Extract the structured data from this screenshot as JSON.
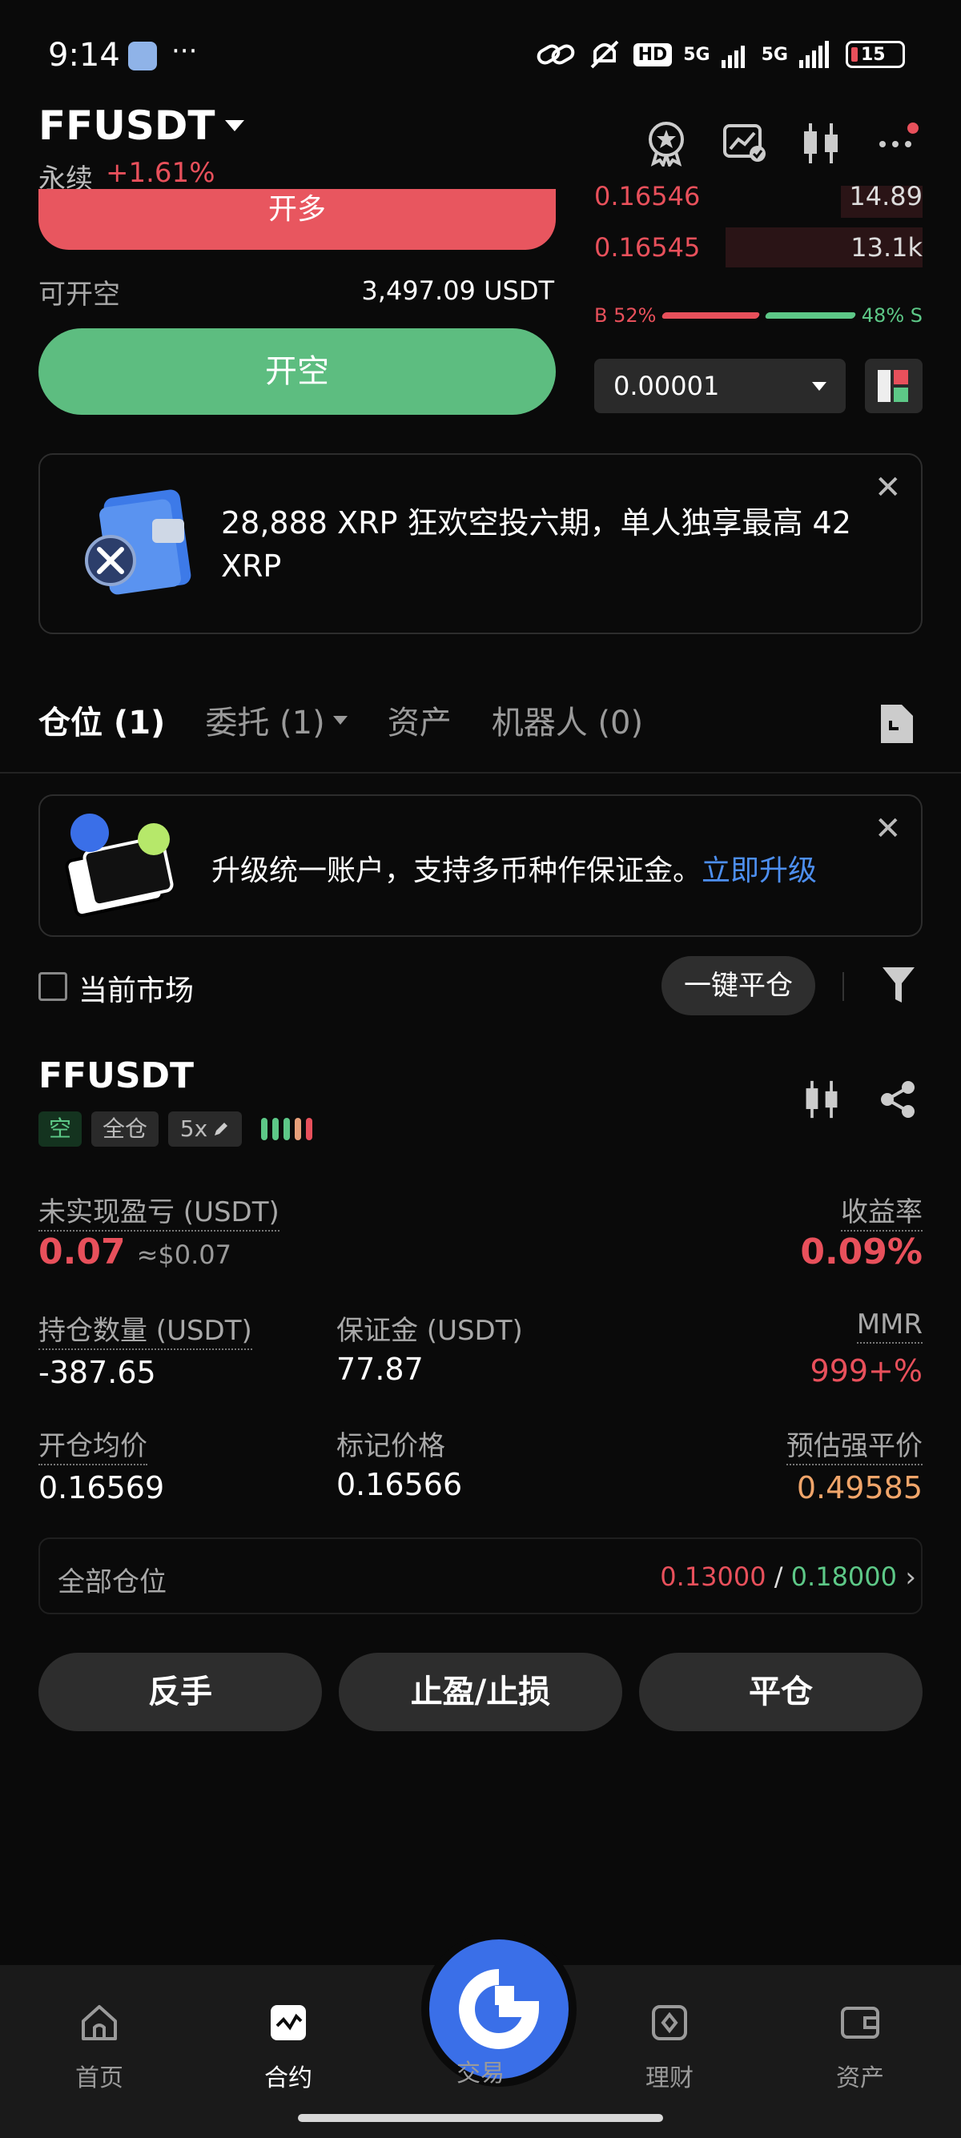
{
  "status_bar": {
    "time": "9:14",
    "dots": "···",
    "network1": "HD",
    "net_5g_a": "5G",
    "net_5g_b": "5G",
    "battery": "15"
  },
  "header": {
    "pair": "FFUSDT",
    "type_label": "永续",
    "change": "+1.61%"
  },
  "order_panel": {
    "long_button": "开多",
    "available_label": "可开空",
    "available_value": "3,497.09 USDT",
    "short_button": "开空"
  },
  "order_book": {
    "rows": [
      {
        "price": "0.16546",
        "qty": "14.89",
        "depth": 0.25
      },
      {
        "price": "0.16545",
        "qty": "13.1k",
        "depth": 0.6
      }
    ],
    "buy_label": "B 52%",
    "sell_label": "48% S",
    "buy_ratio": 52,
    "sell_ratio": 48,
    "tick_size": "0.00001"
  },
  "promo": {
    "text": "28,888 XRP 狂欢空投六期，单人独享最高 42 XRP"
  },
  "tabs": [
    {
      "label": "仓位 (1)"
    },
    {
      "label": "委托 (1)"
    },
    {
      "label": "资产"
    },
    {
      "label": "机器人 (0)"
    }
  ],
  "upgrade": {
    "text": "升级统一账户，支持多币种作保证金。",
    "link": "立即升级"
  },
  "filter": {
    "current_market": "当前市场",
    "close_all": "一键平仓"
  },
  "position": {
    "symbol": "FFUSDT",
    "side_tag": "空",
    "margin_tag": "全仓",
    "leverage_tag": "5x",
    "unrealized_label": "未实现盈亏 (USDT)",
    "unrealized_value": "0.07",
    "unrealized_usd": "≈$0.07",
    "roe_label": "收益率",
    "roe_value": "0.09%",
    "size_label": "持仓数量 (USDT)",
    "size_value": "-387.65",
    "margin_label": "保证金 (USDT)",
    "margin_value": "77.87",
    "mmr_label": "MMR",
    "mmr_value": "999+%",
    "entry_label": "开仓均价",
    "entry_value": "0.16569",
    "mark_label": "标记价格",
    "mark_value": "0.16566",
    "liq_label": "预估强平价",
    "liq_value": "0.49585",
    "all_pos_label": "全部仓位",
    "tp_value": "0.13000",
    "sl_value": "0.18000",
    "slash": "/",
    "chevron": "›"
  },
  "actions": {
    "reverse": "反手",
    "tpsl": "止盈/止损",
    "close": "平仓"
  },
  "bottom_nav": [
    {
      "label": "首页",
      "icon": "home-icon"
    },
    {
      "label": "合约",
      "icon": "futures-icon"
    },
    {
      "label": "交易",
      "icon": "trade-logo-icon"
    },
    {
      "label": "理财",
      "icon": "earn-icon"
    },
    {
      "label": "资产",
      "icon": "wallet-icon"
    }
  ],
  "colors": {
    "red": "#e8505b",
    "green": "#5dc887",
    "blue": "#3a6fe8",
    "orange": "#f0a56a"
  }
}
